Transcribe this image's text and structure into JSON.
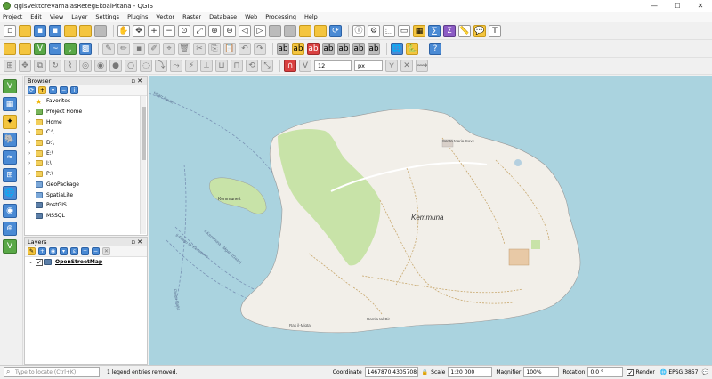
{
  "window": {
    "title": "qgisVektoreVamalasRetegEkoalPitana - QGIS",
    "min": "—",
    "max": "☐",
    "close": "✕"
  },
  "menu": [
    "Project",
    "Edit",
    "View",
    "Layer",
    "Settings",
    "Plugins",
    "Vector",
    "Raster",
    "Database",
    "Web",
    "Processing",
    "Help"
  ],
  "toolbar3": {
    "snap_tolerance": "12",
    "snap_unit": "px"
  },
  "browser": {
    "title": "Browser",
    "items": [
      {
        "label": "Favorites",
        "icon": "star-icon"
      },
      {
        "label": "Project Home",
        "icon": "project-home-icon"
      },
      {
        "label": "Home",
        "icon": "folder-icon"
      },
      {
        "label": "C:\\",
        "icon": "folder-icon"
      },
      {
        "label": "D:\\",
        "icon": "folder-icon"
      },
      {
        "label": "E:\\",
        "icon": "folder-icon"
      },
      {
        "label": "I:\\",
        "icon": "folder-icon"
      },
      {
        "label": "P:\\",
        "icon": "folder-icon"
      },
      {
        "label": "GeoPackage",
        "icon": "geopackage-icon"
      },
      {
        "label": "SpatiaLite",
        "icon": "spatialite-icon"
      },
      {
        "label": "PostGIS",
        "icon": "postgis-icon"
      },
      {
        "label": "MSSQL",
        "icon": "mssql-icon"
      }
    ]
  },
  "layers": {
    "title": "Layers",
    "items": [
      {
        "label": "OpenStreetMap",
        "checked": true
      }
    ]
  },
  "map_labels": {
    "island": "Kemmuna",
    "islet": "Kemmunett",
    "bay": "Santa Maria Cove",
    "route_1": "Mgarr Route",
    "route_2": "Il-Fliegu ta' Kemmuna",
    "route_3": "Il-Kemmuna - Mgarr (Gozo)",
    "route_4": "Fliegu Malta",
    "south_pt": "Ras il-Miqta",
    "lagoon": "Ramla tal-Bir"
  },
  "status": {
    "locator_placeholder": "Type to locate (Ctrl+K)",
    "message": "1 legend entries removed.",
    "coordinate_label": "Coordinate",
    "coordinate": "1467870,4305708",
    "scale_label": "Scale",
    "scale": "1:20 000",
    "magnifier_label": "Magnifier",
    "magnifier": "100%",
    "rotation_label": "Rotation",
    "rotation": "0.0 °",
    "render_label": "Render",
    "crs": "EPSG:3857"
  },
  "colors": {
    "water": "#aad3df",
    "land": "#f2efe9",
    "park": "#c8e3a8",
    "track": "#c8a86e"
  }
}
